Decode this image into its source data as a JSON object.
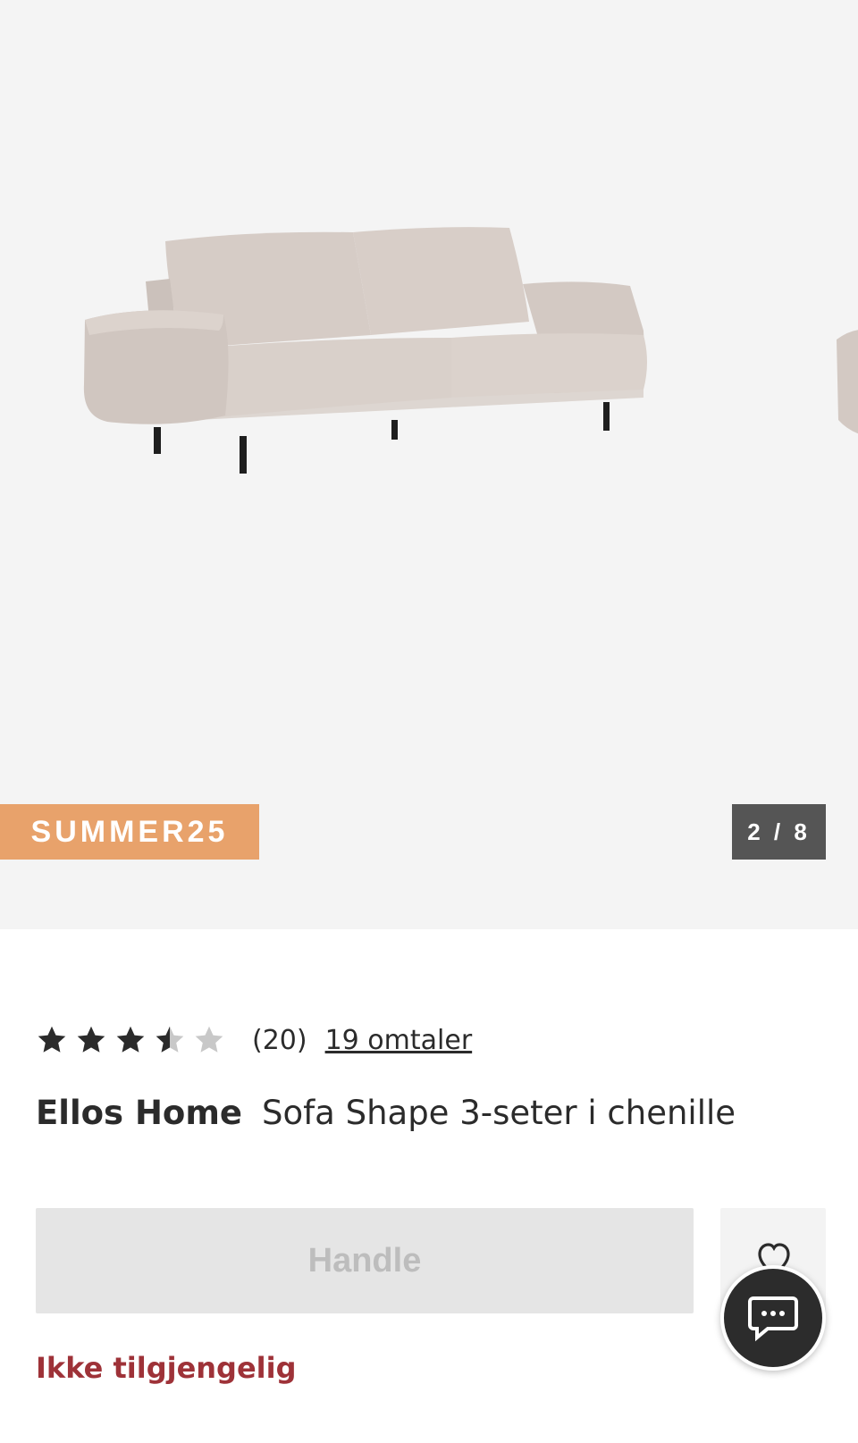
{
  "gallery": {
    "promo_code": "SUMMER25",
    "counter": "2 / 8",
    "current_image": 2,
    "total_images": 8
  },
  "rating": {
    "stars": 3.5,
    "max_stars": 5,
    "count_text": "(20)",
    "reviews_link": "19 omtaler"
  },
  "product": {
    "brand": "Ellos Home",
    "name": "Sofa Shape 3-seter i chenille",
    "availability": "Ikke tilgjengelig"
  },
  "actions": {
    "buy_label": "Handle"
  },
  "colors": {
    "promo_badge": "#e8a26b",
    "counter_badge": "#555555",
    "availability_text": "#9e3238",
    "buy_button_disabled": "#e5e5e5",
    "chat_fab": "#2c2c2c"
  },
  "icons": {
    "wishlist": "heart-icon",
    "chat": "chat-bubble-icon",
    "rating": "star-icon"
  }
}
